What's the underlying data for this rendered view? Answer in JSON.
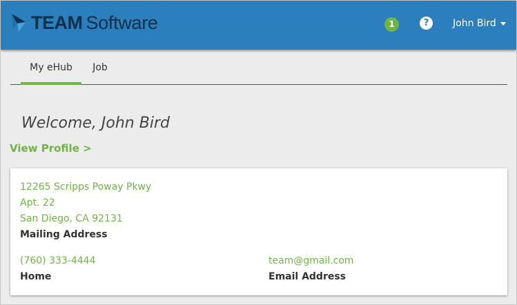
{
  "header": {
    "logo_bold": "TEAM",
    "logo_light": "Software",
    "notification_count": "1",
    "help_symbol": "?",
    "user_name": "John Bird",
    "brand_color": "#2b7fbc",
    "accent_color": "#6fb544"
  },
  "tabs": [
    {
      "label": "My eHub",
      "active": true
    },
    {
      "label": "Job",
      "active": false
    }
  ],
  "main": {
    "welcome": "Welcome, John Bird",
    "view_profile": "View Profile >"
  },
  "card": {
    "address_lines": [
      "12265 Scripps Poway Pkwy",
      "Apt. 22",
      "San Diego, CA 92131"
    ],
    "address_label": "Mailing Address",
    "phone": "(760) 333-4444",
    "phone_label": "Home",
    "email": "team@gmail.com",
    "email_label": "Email Address"
  }
}
